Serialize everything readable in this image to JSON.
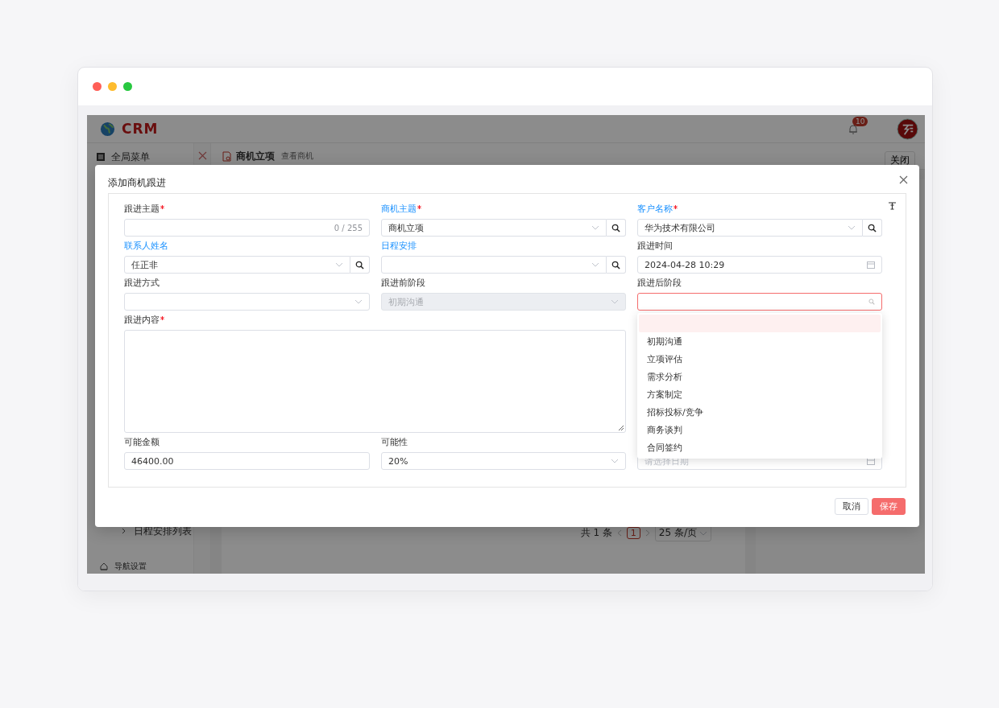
{
  "app": {
    "logo": "CRM",
    "notification_count": "10",
    "sidebar": {
      "items": [
        {
          "kind": "heading",
          "label": "全局菜单"
        },
        {
          "kind": "submenu",
          "label": "日程安排列表",
          "expanded": false
        },
        {
          "kind": "footer",
          "label": "导航设置"
        }
      ]
    },
    "tabs": [
      {
        "label": "商机立项",
        "selected": true
      }
    ],
    "breadcrumb": "查看商机",
    "close_button": "关闭",
    "pagination": {
      "total": "共 1 条",
      "pages": [
        {
          "label": "1",
          "selected": true
        }
      ],
      "page_size": "25 条/页"
    }
  },
  "dialog": {
    "title": "添加商机跟进",
    "fields": [
      {
        "kind": "text",
        "label": "跟进主题",
        "required": true,
        "linked": false,
        "counter": "0 / 255"
      },
      {
        "kind": "lookup",
        "label": "商机主题",
        "required": true,
        "linked": true,
        "value": "商机立项"
      },
      {
        "kind": "lookup",
        "label": "客户名称",
        "required": true,
        "linked": true,
        "value": "华为技术有限公司"
      },
      {
        "kind": "lookup",
        "label": "联系人姓名",
        "required": false,
        "linked": true,
        "value": "任正非"
      },
      {
        "kind": "lookup",
        "label": "日程安排",
        "required": false,
        "linked": true
      },
      {
        "kind": "date",
        "label": "跟进时间",
        "required": false,
        "linked": false,
        "value": "2024-04-28 10:29"
      },
      {
        "kind": "select",
        "label": "跟进方式",
        "required": false,
        "linked": false,
        "disabled": false
      },
      {
        "kind": "select",
        "label": "跟进前阶段",
        "required": false,
        "linked": false,
        "disabled": true,
        "value": "初期沟通"
      },
      {
        "kind": "search-select",
        "label": "跟进后阶段",
        "required": false,
        "linked": false,
        "focused": true,
        "options": [
          {
            "kind": "blank",
            "selected": true
          },
          {
            "kind": "option",
            "label": "初期沟通",
            "selected": false
          },
          {
            "kind": "option",
            "label": "立项评估",
            "selected": false
          },
          {
            "kind": "option",
            "label": "需求分析",
            "selected": false
          },
          {
            "kind": "option",
            "label": "方案制定",
            "selected": false
          },
          {
            "kind": "option",
            "label": "招标投标/竞争",
            "selected": false
          },
          {
            "kind": "option",
            "label": "商务谈判",
            "selected": false
          },
          {
            "kind": "option",
            "label": "合同签约",
            "selected": false
          }
        ]
      },
      {
        "kind": "textarea",
        "label": "跟进内容",
        "required": true,
        "linked": false
      },
      {
        "kind": "text",
        "label": "可能金额",
        "required": false,
        "linked": false,
        "value": "46400.00"
      },
      {
        "kind": "select",
        "label": "可能性",
        "required": false,
        "linked": false,
        "disabled": false,
        "value": "20%"
      },
      {
        "kind": "date",
        "placeholder": "请选择日期"
      }
    ],
    "buttons": [
      {
        "kind": "default",
        "label": "取消"
      },
      {
        "kind": "primary",
        "label": "保存"
      }
    ]
  }
}
